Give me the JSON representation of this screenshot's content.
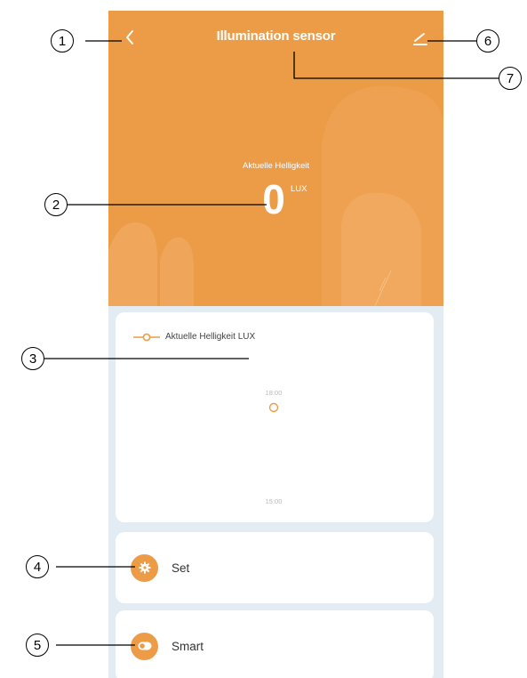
{
  "header": {
    "title": "Illumination sensor",
    "back_icon": "chevron-left-icon",
    "edit_icon": "pencil-icon",
    "background_color": "#ec9c47"
  },
  "reading": {
    "caption": "Aktuelle Helligkeit",
    "value": "0",
    "unit": "LUX"
  },
  "chart": {
    "legend": "Aktuelle Helligkeit LUX",
    "time_labels": [
      "18:00",
      "15:00"
    ]
  },
  "chart_data": {
    "type": "line",
    "series": [
      {
        "name": "Aktuelle Helligkeit LUX",
        "values": [
          0
        ]
      }
    ],
    "x": [
      "18:00"
    ],
    "tick_labels": [
      "18:00",
      "15:00"
    ],
    "accent_color": "#ec9c47"
  },
  "menu": {
    "set": {
      "label": "Set",
      "icon": "gear-icon"
    },
    "smart": {
      "label": "Smart",
      "icon": "toggle-icon"
    }
  },
  "callouts": [
    "1",
    "2",
    "3",
    "4",
    "5",
    "6",
    "7"
  ]
}
